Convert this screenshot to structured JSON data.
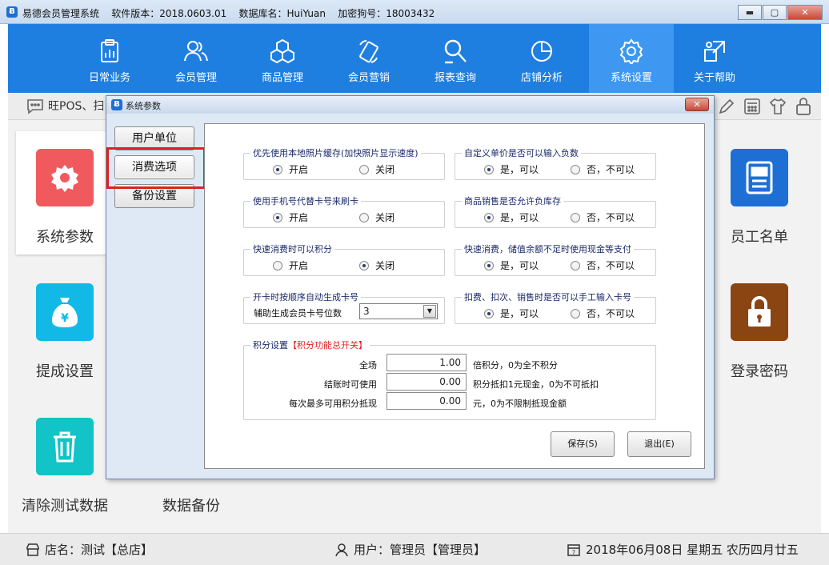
{
  "window": {
    "title": "易德会员管理系统    软件版本：2018.0603.01    数据库名：HuiYuan    加密狗号：18003432",
    "min": "▬",
    "max": "▢",
    "close": "✕"
  },
  "nav": [
    {
      "label": "日常业务",
      "icon": "clipboard-icon"
    },
    {
      "label": "会员管理",
      "icon": "members-icon"
    },
    {
      "label": "商品管理",
      "icon": "boxes-icon"
    },
    {
      "label": "会员营销",
      "icon": "phone-tag-icon"
    },
    {
      "label": "报表查询",
      "icon": "report-search-icon"
    },
    {
      "label": "店铺分析",
      "icon": "pie-chart-icon"
    },
    {
      "label": "系统设置",
      "icon": "gear-icon",
      "active": true
    },
    {
      "label": "关于帮助",
      "icon": "help-icon"
    }
  ],
  "infobar": {
    "message": "旺POS、扫"
  },
  "tiles": {
    "system_params": "系统参数",
    "commission": "提成设置",
    "clear_test": "清除测试数据",
    "backup": "数据备份",
    "staff": "员工名单",
    "login_pwd": "登录密码"
  },
  "status": {
    "store": "店名：测试【总店】",
    "user": "用户：管理员【管理员】",
    "date": "2018年06月08日  星期五  农历四月廿五"
  },
  "dialog": {
    "title": "系统参数",
    "close": "✕",
    "side": [
      "用户单位",
      "消费选项",
      "备份设置"
    ],
    "groups": {
      "g1": {
        "title": "优先使用本地照片缓存(加快照片显示速度)",
        "opt1": "开启",
        "opt2": "关闭"
      },
      "g2": {
        "title": "自定义单价是否可以输入负数",
        "opt1": "是，可以",
        "opt2": "否，不可以"
      },
      "g3": {
        "title": "使用手机号代替卡号来刷卡",
        "opt1": "开启",
        "opt2": "关闭"
      },
      "g4": {
        "title": "商品销售是否允许负库存",
        "opt1": "是，可以",
        "opt2": "否，不可以"
      },
      "g5": {
        "title": "快速消费时可以积分",
        "opt1": "开启",
        "opt2": "关闭"
      },
      "g6": {
        "title": "快速消费，储值余额不足时使用现金等支付",
        "opt1": "是，可以",
        "opt2": "否，不可以"
      },
      "g7": {
        "title": "开卡时按顺序自动生成卡号",
        "label": "辅助生成会员卡号位数",
        "value": "3"
      },
      "g8": {
        "title": "扣费、扣次、销售时是否可以手工输入卡号",
        "opt1": "是，可以",
        "opt2": "否，不可以"
      }
    },
    "points": {
      "title": "积分设置",
      "title_red": "【积分功能总开关】",
      "rows": [
        {
          "label": "全场",
          "value": "1.00",
          "note": "倍积分，0为全不积分"
        },
        {
          "label": "结账时可使用",
          "value": "0.00",
          "note": "积分抵扣1元现金，0为不可抵扣"
        },
        {
          "label": "每次最多可用积分抵现",
          "value": "0.00",
          "note": "元，0为不限制抵现金额"
        }
      ]
    },
    "save": "保存(S)",
    "exit": "退出(E)"
  },
  "colors": {
    "nav_bg": "#1f7fe0",
    "nav_active": "#3e97f0",
    "red_tile": "#f05a5f",
    "cyan_tile": "#12b9e6",
    "blue_tile": "#1d6fd6",
    "brown_tile": "#8b4513"
  }
}
